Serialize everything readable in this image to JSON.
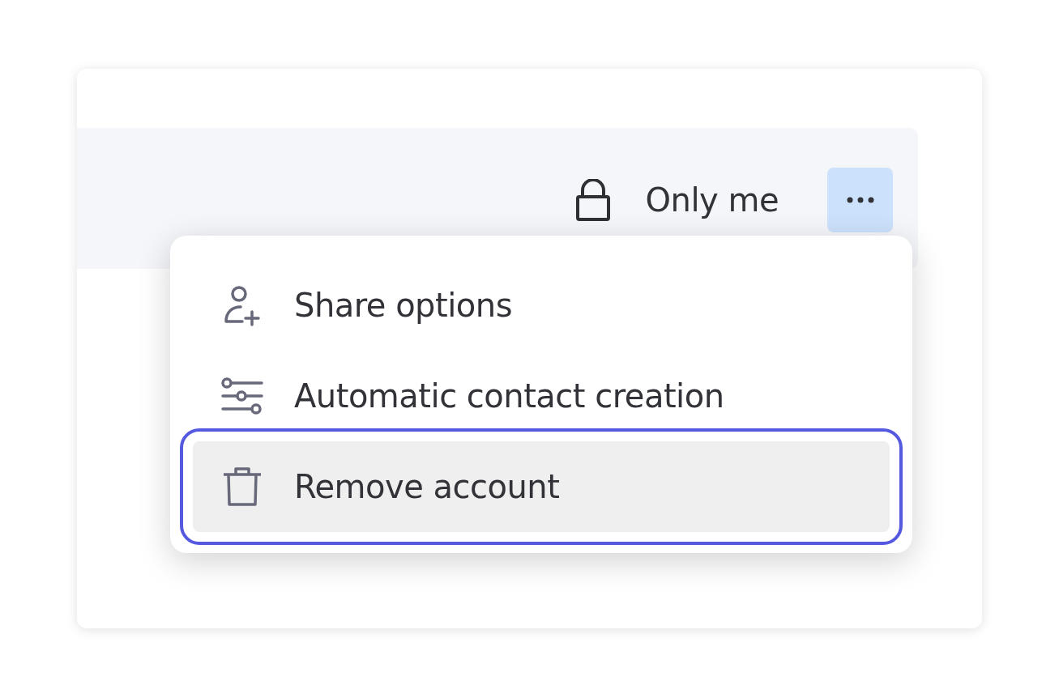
{
  "access": {
    "label": "Only me"
  },
  "more_button": {
    "expanded": true
  },
  "menu": {
    "items": [
      {
        "kind": "share",
        "label": "Share options",
        "selected": false
      },
      {
        "kind": "sliders",
        "label": "Automatic contact creation",
        "selected": false
      },
      {
        "kind": "trash",
        "label": "Remove account",
        "selected": true
      }
    ]
  }
}
